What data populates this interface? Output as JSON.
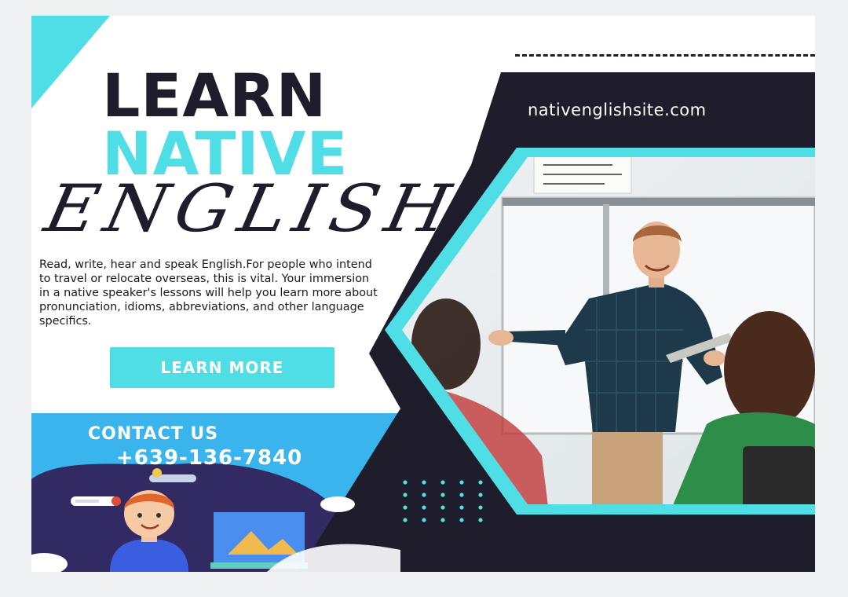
{
  "headline": {
    "line1": "LEARN",
    "line2": "NATIVE",
    "line3": "ENGLISH"
  },
  "description": "Read, write, hear and speak English.For people who intend to travel or relocate overseas, this is vital. Your immersion in a native speaker's lessons will help you learn more about pronunciation, idioms, abbreviations, and other language specifics.",
  "cta": {
    "label": "LEARN MORE"
  },
  "contact": {
    "title": "CONTACT US",
    "phone": "+639-136-7840"
  },
  "website": "nativenglishsite.com",
  "colors": {
    "accent": "#4fdde6",
    "dark": "#1f1d2c",
    "contact_band": "#3ab4ec",
    "background": "#ffffff"
  },
  "icons": [
    "dot-grid-icon",
    "rocket-icon",
    "boy-illustration",
    "laptop-icon"
  ],
  "photo": {
    "subject": "teacher-classroom-photo"
  }
}
